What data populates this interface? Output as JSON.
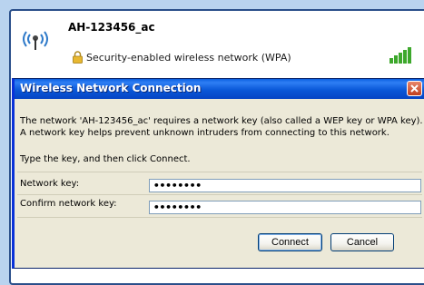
{
  "network": {
    "name": "AH-123456_ac",
    "security": "Security-enabled wireless network (WPA)",
    "signal_strength": 5
  },
  "dialog": {
    "title": "Wireless Network Connection",
    "description": "The network 'AH-123456_ac' requires a network key (also called a WEP key or WPA key). A network key helps prevent unknown intruders from connecting to this network.",
    "instruction": "Type the key, and then click Connect.",
    "network_key_label": "Network key:",
    "network_key_value": "••••••••",
    "confirm_key_label": "Confirm network key:",
    "confirm_key_value": "••••••••",
    "connect_label": "Connect",
    "cancel_label": "Cancel"
  },
  "colors": {
    "titlebar": "#0a58d8",
    "dialog_bg": "#ece9d8",
    "signal_green": "#3da82c"
  }
}
